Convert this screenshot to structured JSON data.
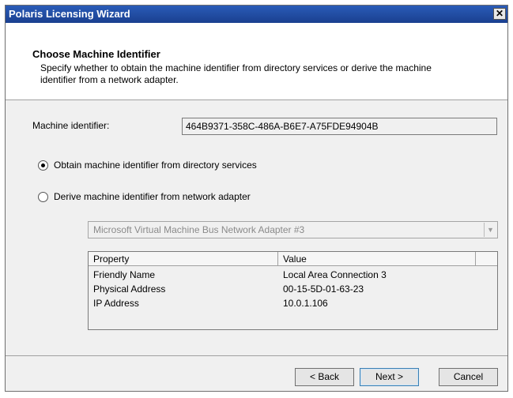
{
  "window": {
    "title": "Polaris Licensing Wizard"
  },
  "header": {
    "title": "Choose Machine Identifier",
    "description": "Specify whether to obtain the machine identifier from directory services or derive the machine identifier from a network adapter."
  },
  "machine_identifier": {
    "label": "Machine identifier:",
    "value": "464B9371-358C-486A-B6E7-A75FDE94904B"
  },
  "options": {
    "directory_services": {
      "label": "Obtain machine identifier from directory services",
      "checked": true
    },
    "network_adapter": {
      "label": "Derive machine identifier from network adapter",
      "checked": false
    }
  },
  "adapter_select": {
    "value": "Microsoft Virtual Machine Bus Network Adapter #3"
  },
  "properties_table": {
    "columns": [
      "Property",
      "Value"
    ],
    "rows": [
      [
        "Friendly Name",
        "Local Area Connection 3"
      ],
      [
        "Physical Address",
        "00-15-5D-01-63-23"
      ],
      [
        "IP Address",
        "10.0.1.106"
      ]
    ]
  },
  "buttons": {
    "back": "< Back",
    "next": "Next >",
    "cancel": "Cancel"
  }
}
